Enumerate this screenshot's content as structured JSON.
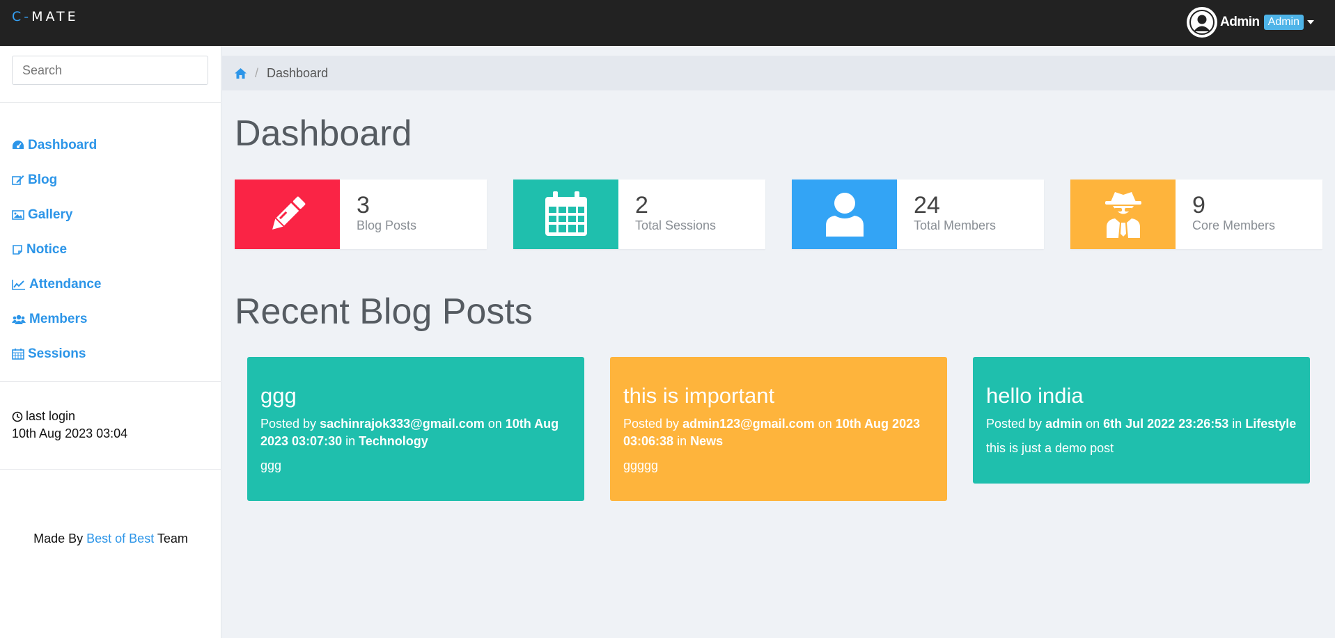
{
  "brand": {
    "prefix": "C-",
    "name": "MATE"
  },
  "user": {
    "name": "Admin",
    "role": "Admin"
  },
  "search": {
    "placeholder": "Search"
  },
  "sidebar": {
    "items": [
      {
        "label": "Dashboard",
        "icon": "dashboard-icon"
      },
      {
        "label": "Blog",
        "icon": "edit-icon"
      },
      {
        "label": "Gallery",
        "icon": "image-icon"
      },
      {
        "label": "Notice",
        "icon": "sticky-note-icon"
      },
      {
        "label": "Attendance",
        "icon": "line-chart-icon"
      },
      {
        "label": "Members",
        "icon": "users-icon"
      },
      {
        "label": "Sessions",
        "icon": "calendar-icon"
      }
    ],
    "last_login_label": "last login",
    "last_login_value": "10th Aug 2023 03:04",
    "footer": {
      "prefix": "Made By ",
      "link": "Best of Best",
      "suffix": " Team"
    }
  },
  "breadcrumb": {
    "current": "Dashboard"
  },
  "page_title": "Dashboard",
  "stats": [
    {
      "value": "3",
      "label": "Blog Posts",
      "color": "#fa2445",
      "icon": "pencil-icon"
    },
    {
      "value": "2",
      "label": "Total Sessions",
      "color": "#1fbfad",
      "icon": "calendar-icon"
    },
    {
      "value": "24",
      "label": "Total Members",
      "color": "#33a4f5",
      "icon": "user-icon"
    },
    {
      "value": "9",
      "label": "Core Members",
      "color": "#feb43c",
      "icon": "user-secret-icon"
    }
  ],
  "recent_title": "Recent Blog Posts",
  "posts": [
    {
      "title": "ggg",
      "posted_by_label": "Posted by ",
      "author": "sachinrajok333@gmail.com",
      "on_label": " on ",
      "date": "10th Aug 2023 03:07:30",
      "in_label": " in ",
      "category": "Technology",
      "excerpt": "ggg",
      "color": "#1fbfad"
    },
    {
      "title": "this is important",
      "posted_by_label": "Posted by ",
      "author": "admin123@gmail.com",
      "on_label": " on ",
      "date": "10th Aug 2023 03:06:38",
      "in_label": " in ",
      "category": "News",
      "excerpt": "ggggg",
      "color": "#feb43c"
    },
    {
      "title": "hello india",
      "posted_by_label": "Posted by ",
      "author": "admin",
      "on_label": " on ",
      "date": "6th Jul 2022 23:26:53",
      "in_label": " in ",
      "category": "Lifestyle",
      "excerpt": "this is just a demo post",
      "color": "#1fbfad"
    }
  ]
}
